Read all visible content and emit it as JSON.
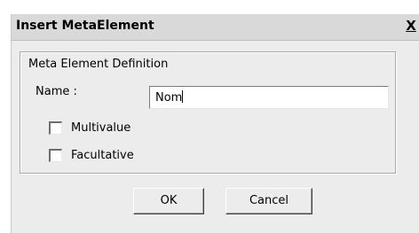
{
  "window": {
    "title": "Insert MetaElement",
    "close_glyph": "X"
  },
  "group": {
    "legend": "Meta Element Definition"
  },
  "name_field": {
    "label": "Name :",
    "value": "Nom"
  },
  "options": [
    {
      "label": "Multivalue",
      "checked": false
    },
    {
      "label": "Facultative",
      "checked": false
    }
  ],
  "buttons": {
    "ok_label": "OK",
    "cancel_label": "Cancel"
  },
  "colors": {
    "dialog_bg": "#ececec",
    "titlebar_bg": "#d9d9d9",
    "input_bg": "#ffffff"
  }
}
